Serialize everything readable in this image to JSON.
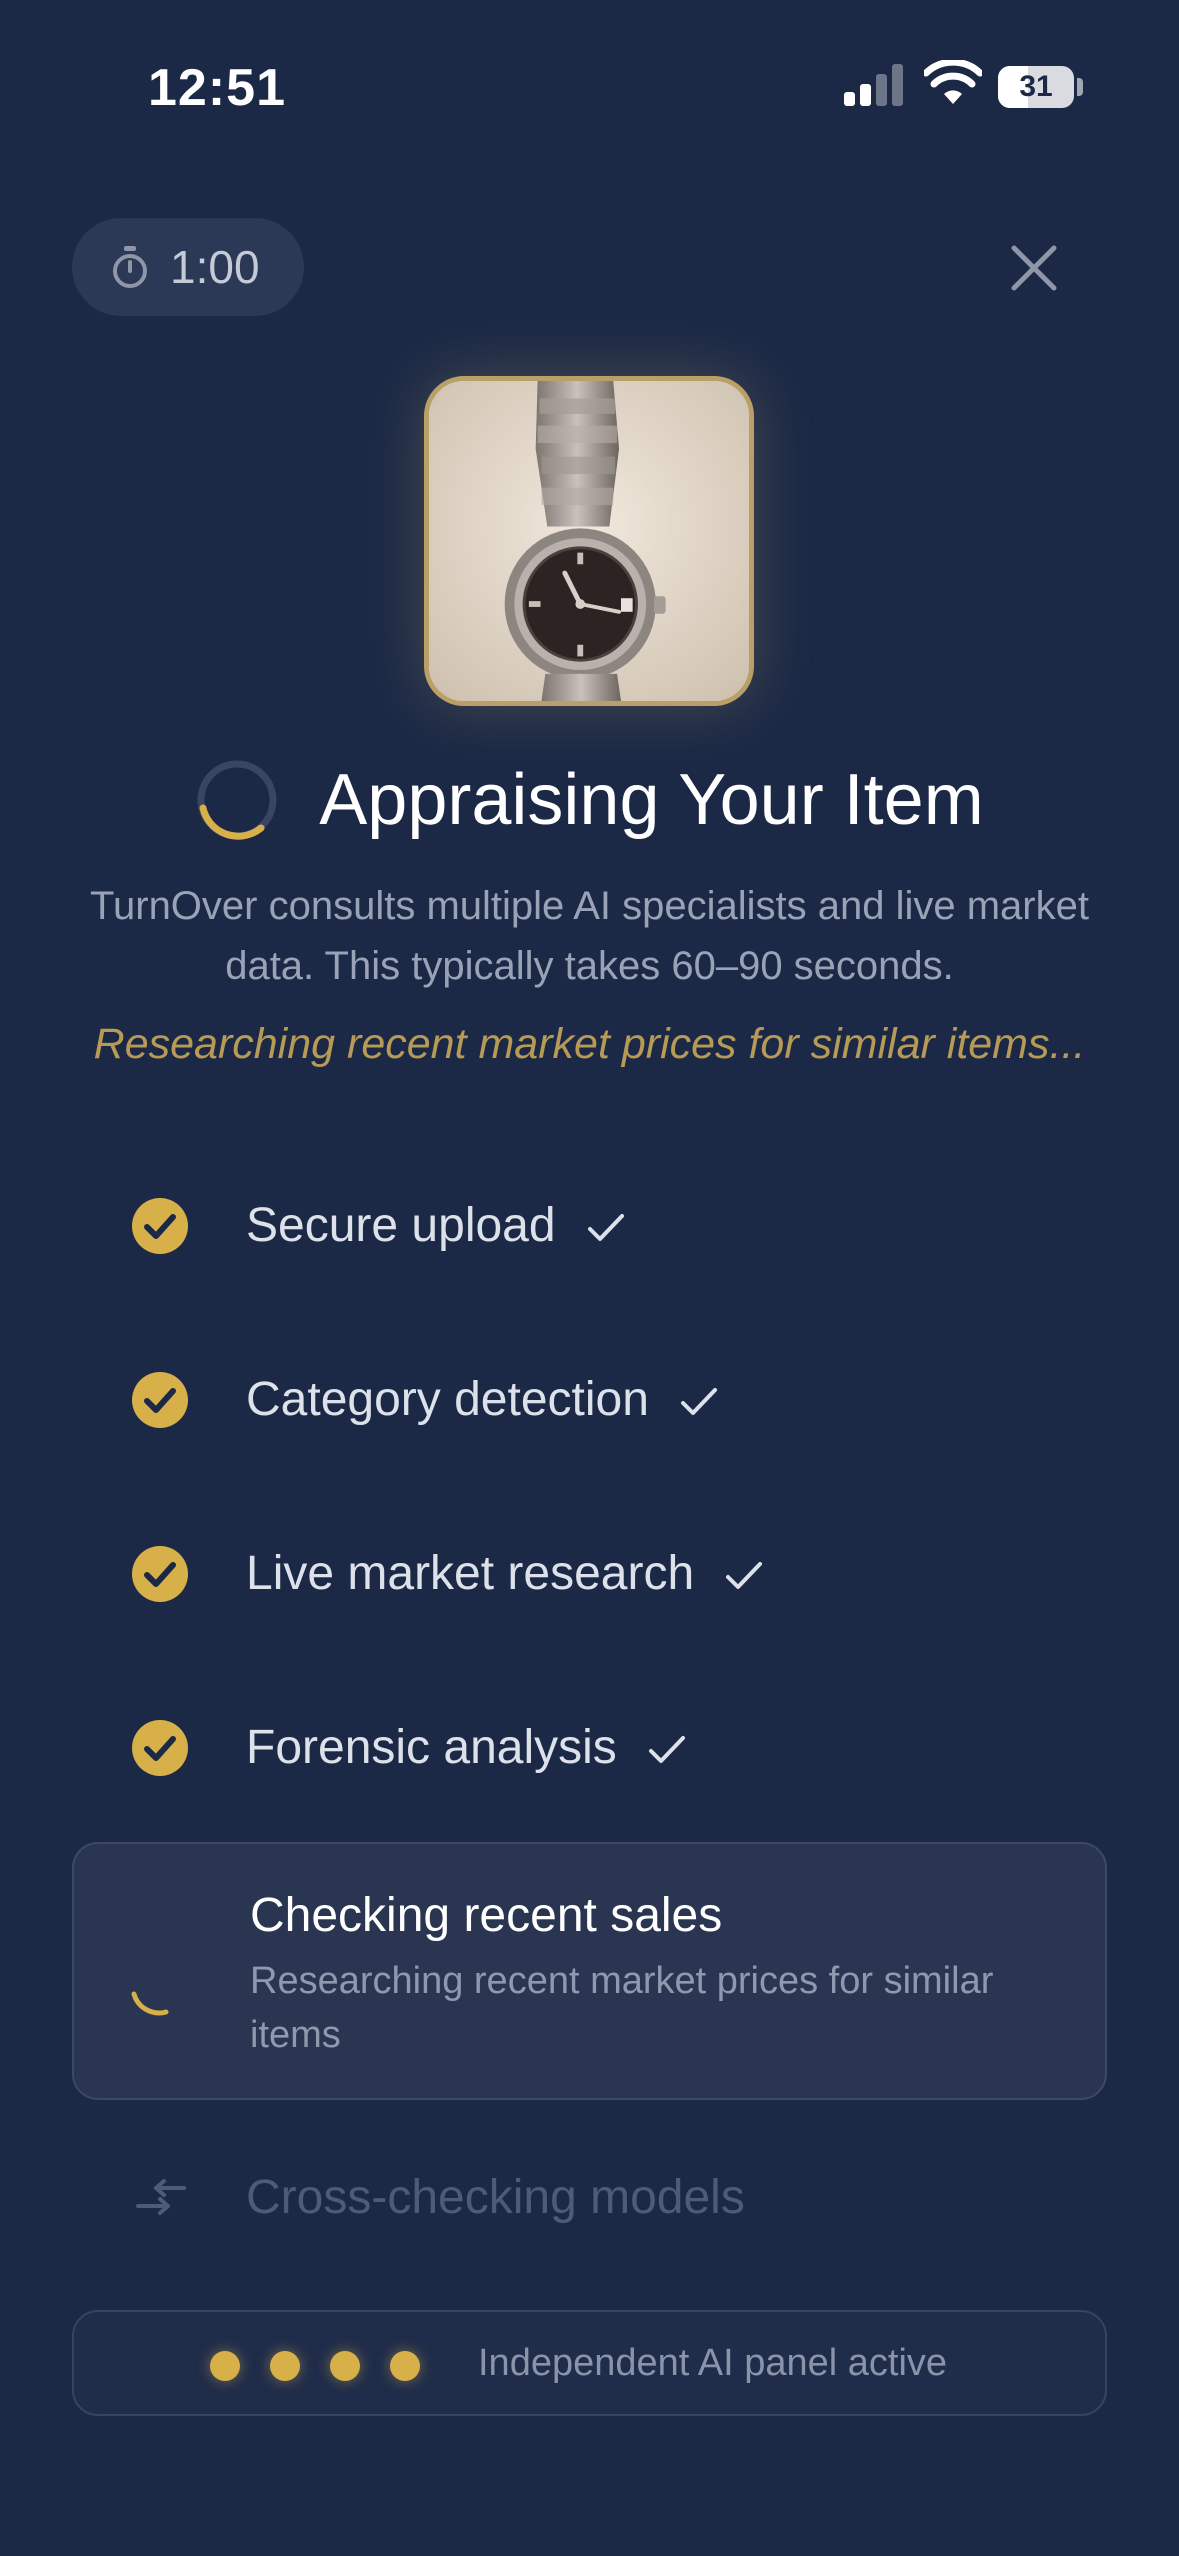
{
  "status_bar": {
    "time": "12:51",
    "battery": "31"
  },
  "header": {
    "timer": "1:00",
    "close_icon": "close-icon"
  },
  "item_photo": {
    "description_icon": "watch-photo"
  },
  "main": {
    "title": "Appraising Your Item",
    "subtitle": "TurnOver consults multiple AI specialists and live market data. This typically takes 60–90 seconds.",
    "status_line": "Researching recent market prices for similar items..."
  },
  "steps": [
    {
      "label": "Secure upload",
      "state": "done"
    },
    {
      "label": "Category detection",
      "state": "done"
    },
    {
      "label": "Live market research",
      "state": "done"
    },
    {
      "label": "Forensic analysis",
      "state": "done"
    }
  ],
  "active_step": {
    "title": "Checking recent sales",
    "subtitle": "Researching recent market prices for similar items"
  },
  "pending_step": {
    "label": "Cross-checking models"
  },
  "panel": {
    "text": "Independent AI panel active",
    "dots": 4
  },
  "colors": {
    "background": "#1c2946",
    "accent_gold": "#d7b04a",
    "status_italic": "#b79a55"
  }
}
